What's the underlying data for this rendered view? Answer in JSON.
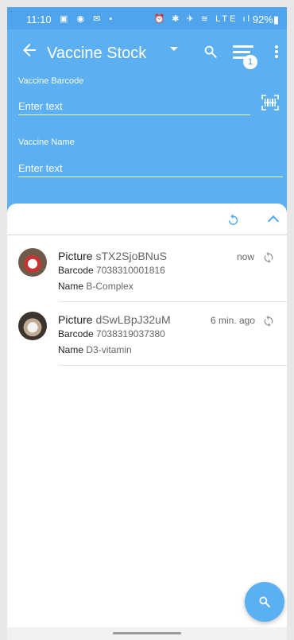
{
  "status_bar": {
    "time": "11:10",
    "left_icons": "▣ ◉ ✉ •",
    "right_icons": "⏰ ✱ ✈ ≋ LTE ıl",
    "battery": "92%▮"
  },
  "toolbar": {
    "title": "Vaccine Stock",
    "filter_badge": "1",
    "icons": [
      "back-arrow-icon",
      "dropdown-caret-icon",
      "search-icon",
      "filter-list-icon",
      "more-vert-icon"
    ]
  },
  "form": {
    "barcode_label": "Vaccine Barcode",
    "barcode_placeholder": "Enter text",
    "name_label": "Vaccine Name",
    "name_placeholder": "Enter text"
  },
  "list": {
    "picture_label": "Picture",
    "barcode_label": "Barcode",
    "name_label": "Name",
    "items": [
      {
        "picture": "sTX2SjoBNuS",
        "barcode": "7038310001816",
        "name": "B-Complex",
        "time": "now"
      },
      {
        "picture": "dSwLBpJ32uM",
        "barcode": "7038319037380",
        "name": "D3-vitamin",
        "time": "6 min. ago"
      }
    ]
  },
  "colors": {
    "primary": "#5cb0f2",
    "status_bar": "#4fa4ec",
    "accent": "#52a8ee"
  }
}
